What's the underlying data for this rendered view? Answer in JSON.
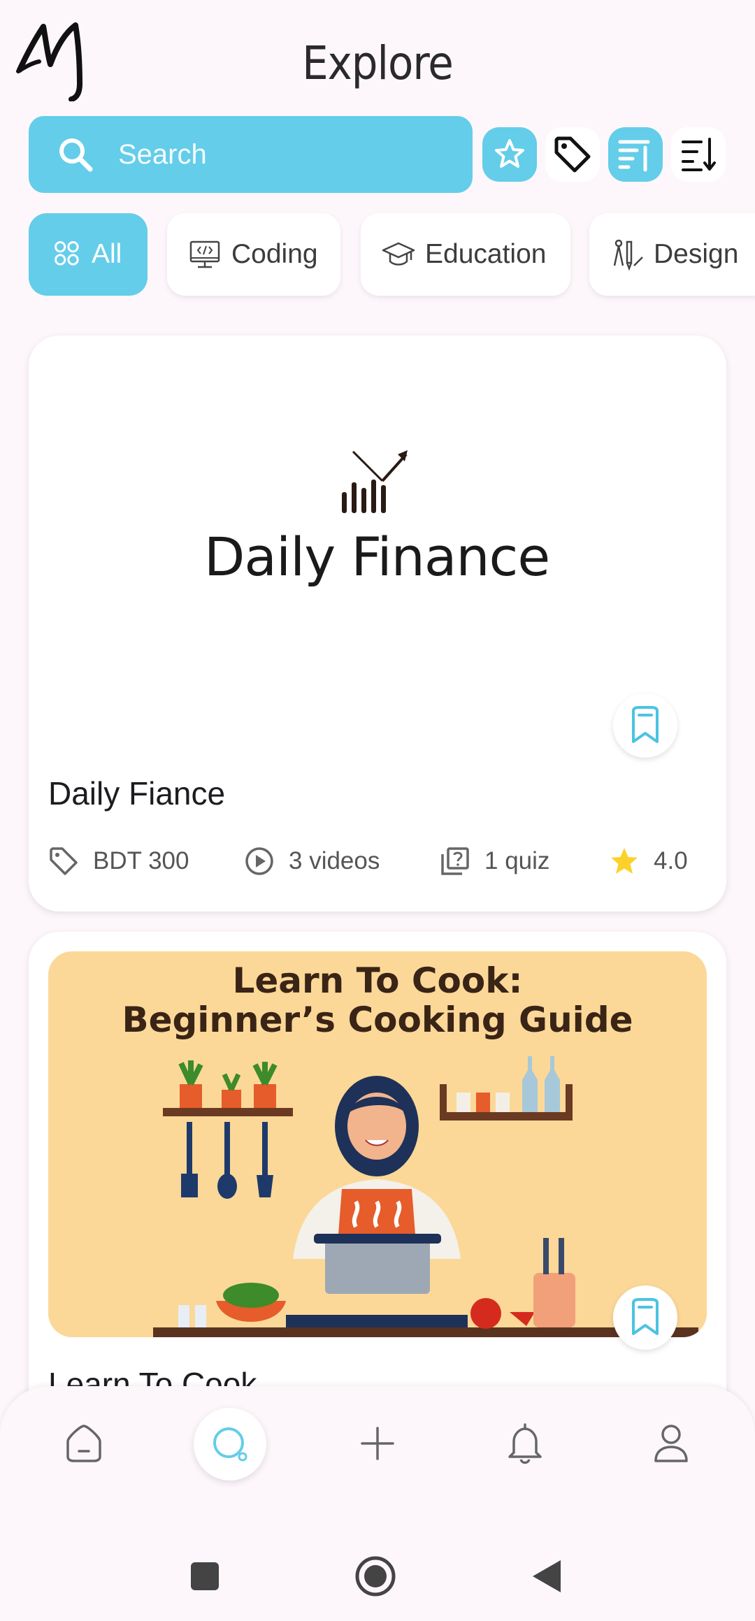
{
  "header": {
    "title": "Explore"
  },
  "search": {
    "placeholder": "Search"
  },
  "categories": [
    {
      "label": "All",
      "icon": "grid-icon",
      "active": true
    },
    {
      "label": "Coding",
      "icon": "monitor-code-icon",
      "active": false
    },
    {
      "label": "Education",
      "icon": "graduation-cap-icon",
      "active": false
    },
    {
      "label": "Design",
      "icon": "design-tools-icon",
      "active": false
    }
  ],
  "courses": [
    {
      "thumbnail_heading": "Daily Finance",
      "title": "Daily Fiance",
      "price": "BDT 300",
      "videos": "3 videos",
      "quiz": "1 quiz",
      "rating": "4.0"
    },
    {
      "thumbnail_heading_line1": "Learn To Cook:",
      "thumbnail_heading_line2": "Beginner’s Cooking Guide",
      "title": "Learn To Cook"
    }
  ],
  "colors": {
    "accent": "#64cde9",
    "star": "#fcd12a",
    "background": "#fdf7fb"
  }
}
